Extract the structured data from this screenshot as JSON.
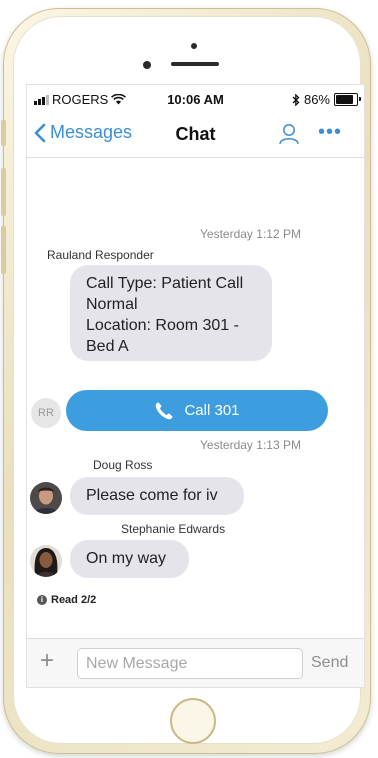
{
  "statusbar": {
    "carrier": "ROGERS",
    "time": "10:06 AM",
    "battery": "86%",
    "battery_level": 0.86,
    "icons": [
      "signal-icon",
      "wifi-icon",
      "bluetooth-icon",
      "battery-icon"
    ]
  },
  "navbar": {
    "back_label": "Messages",
    "title": "Chat",
    "accent": "#3a8fd6"
  },
  "chat": {
    "timestamp_1": {
      "day": "Yesterday",
      "time": "1:12 PM"
    },
    "sender_1": "Rauland Responder",
    "bubble_1": [
      "Call Type: Patient Call",
      "Normal",
      "Location: Room 301 -",
      "Bed A"
    ],
    "avatar_rr": "RR",
    "call_button": {
      "label": "Call 301",
      "color": "#3d9ddf"
    },
    "timestamp_2": {
      "day": "Yesterday",
      "time": "1:13 PM"
    },
    "sender_2": "Doug Ross",
    "bubble_2": "Please come for iv",
    "sender_3": "Stephanie Edwards",
    "bubble_3": "On my way",
    "read_receipt": "Read 2/2"
  },
  "composer": {
    "placeholder": "New Message",
    "send_label": "Send"
  }
}
